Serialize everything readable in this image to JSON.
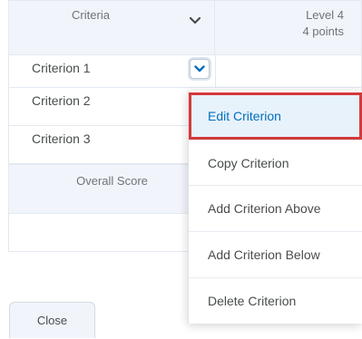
{
  "header": {
    "criteria_label": "Criteria",
    "level_name": "Level 4",
    "level_points": "4 points"
  },
  "rows": [
    {
      "label": "Criterion 1"
    },
    {
      "label": "Criterion 2"
    },
    {
      "label": "Criterion 3"
    }
  ],
  "overall": {
    "label": "Overall Score"
  },
  "menu": {
    "items": [
      {
        "label": "Edit Criterion"
      },
      {
        "label": "Copy Criterion"
      },
      {
        "label": "Add Criterion Above"
      },
      {
        "label": "Add Criterion Below"
      },
      {
        "label": "Delete Criterion"
      }
    ]
  },
  "footer": {
    "close_label": "Close"
  },
  "colors": {
    "header_bg": "#f1f5fb",
    "highlight_border": "#d33a3a",
    "highlight_text": "#006fbf",
    "highlight_bg": "#e8f2fb"
  },
  "icons": {
    "criteria_dropdown": "chevron-down-icon",
    "criterion_menu": "chevron-down-icon"
  }
}
